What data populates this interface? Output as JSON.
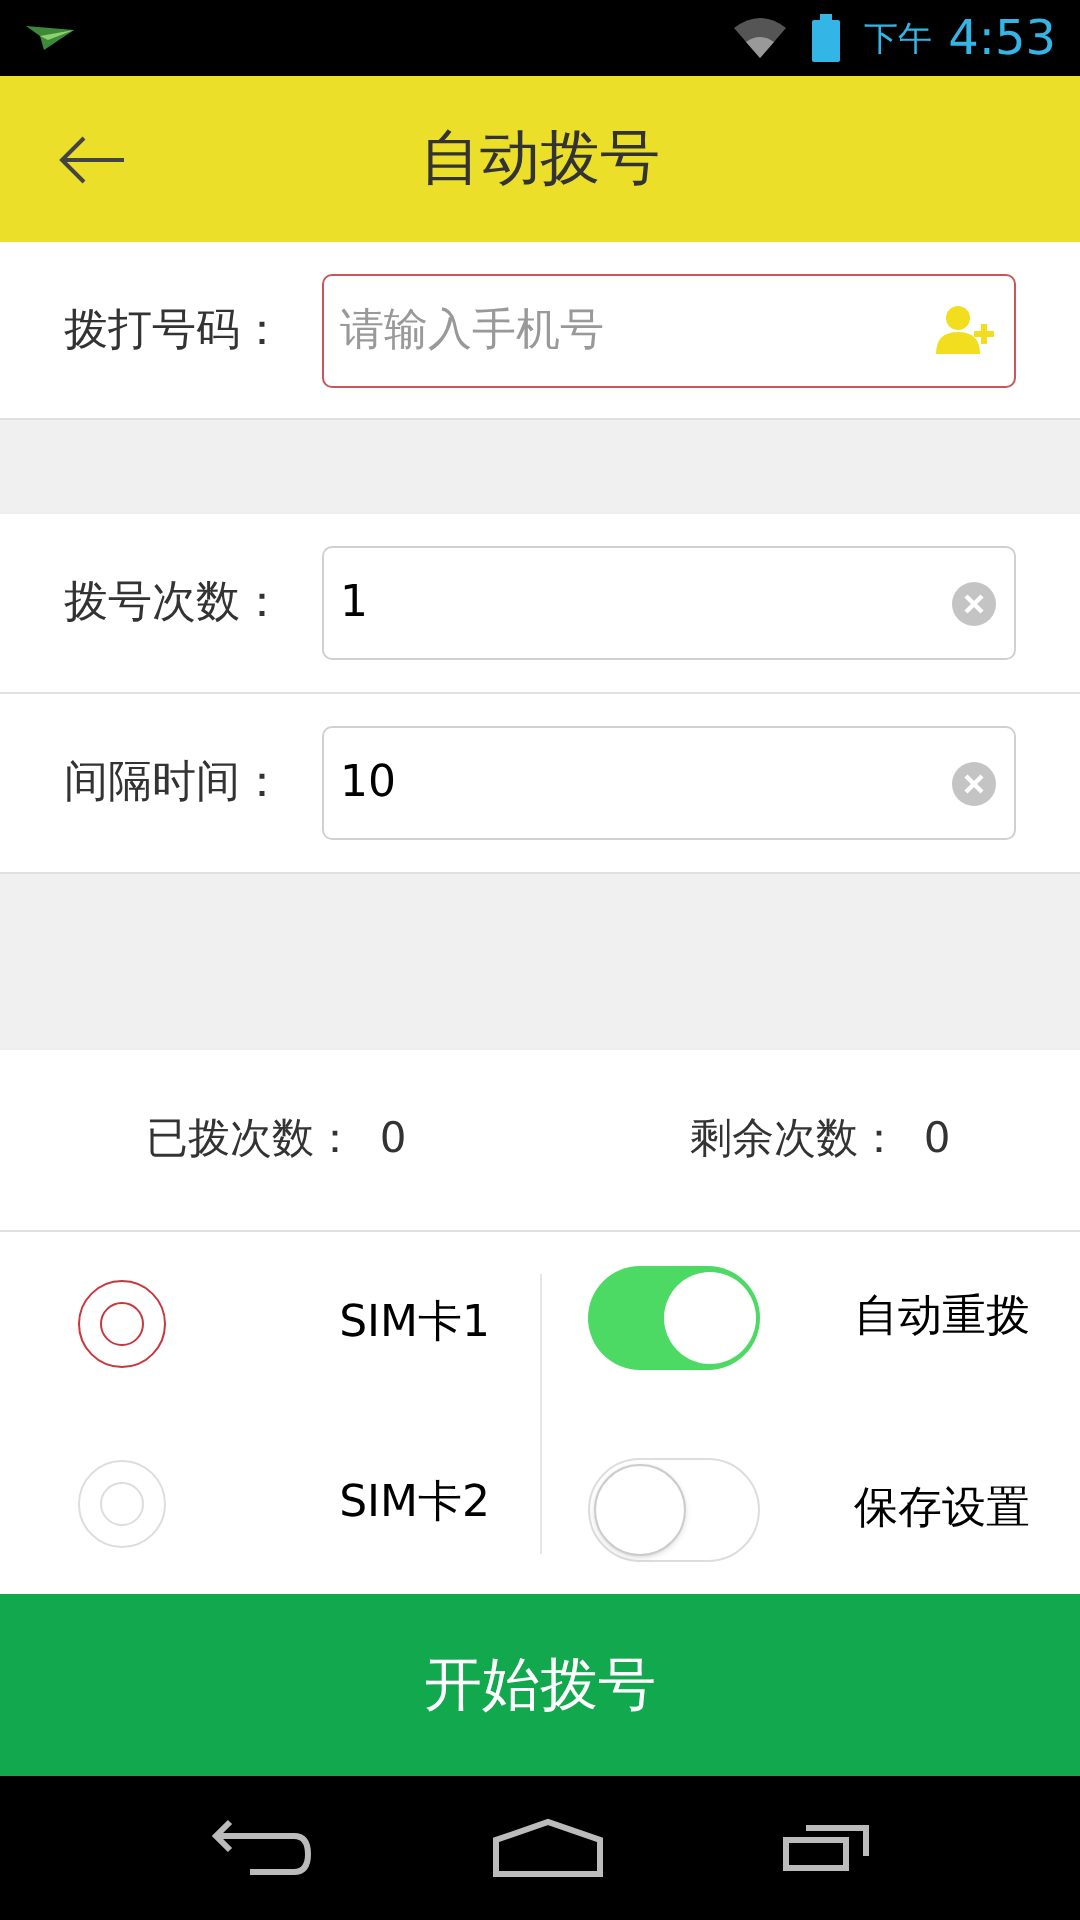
{
  "status_bar": {
    "period": "下午",
    "time": "4:53"
  },
  "header": {
    "title": "自动拨号"
  },
  "phone": {
    "label": "拨打号码：",
    "placeholder": "请输入手机号"
  },
  "fields": [
    {
      "label": "拨号次数：",
      "value": "1"
    },
    {
      "label": "间隔时间：",
      "value": "10"
    }
  ],
  "counters": [
    {
      "label": "已拨次数：",
      "value": "0"
    },
    {
      "label": "剩余次数：",
      "value": "0"
    }
  ],
  "sims": [
    {
      "label": "SIM卡1",
      "selected": true
    },
    {
      "label": "SIM卡2",
      "selected": false
    }
  ],
  "toggles": [
    {
      "label": "自动重拨",
      "on": true
    },
    {
      "label": "保存设置",
      "on": false
    }
  ],
  "start_button": {
    "label": "开始拨号"
  }
}
